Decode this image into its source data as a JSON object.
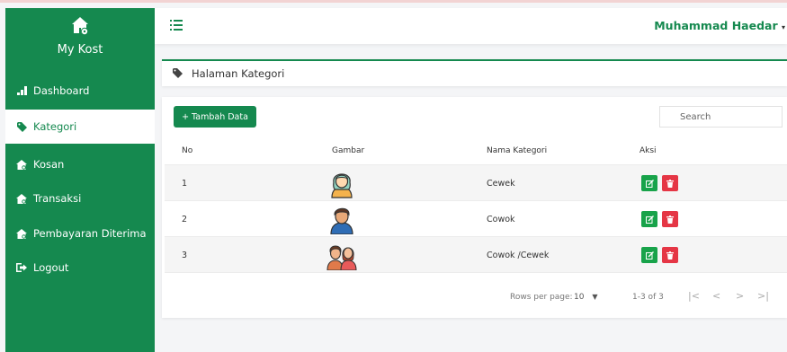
{
  "sidebar": {
    "brand": "My Kost",
    "items": [
      {
        "label": "Dashboard",
        "icon": "bar-chart-icon"
      },
      {
        "label": "Kategori",
        "icon": "tag-icon"
      },
      {
        "label": "Kosan",
        "icon": "home-icon"
      },
      {
        "label": "Transaksi",
        "icon": "home-icon"
      },
      {
        "label": "Pembayaran Diterima",
        "icon": "home-icon"
      },
      {
        "label": "Logout",
        "icon": "logout-icon"
      }
    ],
    "active": "Kategori"
  },
  "topbar": {
    "user_name": "Muhammad Haedar"
  },
  "breadcrumb": {
    "label": "Halaman Kategori"
  },
  "toolbar": {
    "add_label": "+ Tambah Data",
    "search_placeholder": "Search"
  },
  "table": {
    "headers": {
      "no": "No",
      "image": "Gambar",
      "name": "Nama Kategori",
      "action": "Aksi"
    },
    "rows": [
      {
        "no": "1",
        "name": "Cewek",
        "image": "woman-avatar"
      },
      {
        "no": "2",
        "name": "Cowok",
        "image": "man-avatar"
      },
      {
        "no": "3",
        "name": "Cowok /Cewek",
        "image": "couple-avatar"
      }
    ]
  },
  "pagination": {
    "rows_per_page_label": "Rows per page:",
    "rows_per_page_value": "10",
    "range": "1-3 of 3"
  },
  "colors": {
    "primary": "#15894f",
    "edit": "#18a34a",
    "delete": "#e53645"
  }
}
